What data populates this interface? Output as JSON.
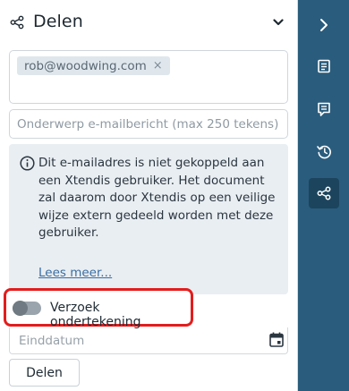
{
  "header": {
    "title": "Delen",
    "icon": "share-icon",
    "collapse_icon": "chevron-down-icon"
  },
  "recipients": {
    "chips": [
      {
        "label": "rob@woodwing.com",
        "remove": "×"
      }
    ]
  },
  "subject": {
    "value": "",
    "placeholder": "Onderwerp e-mailbericht (max 250 tekens)"
  },
  "info": {
    "icon": "info-icon",
    "message": "Dit e-mailadres is niet gekoppeld aan een Xtendis gebruiker. Het document zal daarom door Xtendis op een veilige wijze extern gedeeld worden met deze gebruiker.",
    "link": "Lees meer..."
  },
  "signature_request": {
    "label": "Verzoek ondertekening",
    "enabled": false
  },
  "end_date": {
    "value": "",
    "placeholder": "Einddatum",
    "icon": "calendar-icon"
  },
  "actions": {
    "share_label": "Delen"
  },
  "rail": {
    "items": [
      {
        "icon": "chevron-right-icon",
        "active": false
      },
      {
        "icon": "document-icon",
        "active": false
      },
      {
        "icon": "comment-icon",
        "active": false
      },
      {
        "icon": "history-icon",
        "active": false
      },
      {
        "icon": "share-icon",
        "active": true
      }
    ]
  },
  "colors": {
    "rail_bg": "#2a5c7d",
    "rail_active": "#1c445d",
    "highlight_border": "#e31d1d",
    "info_bg": "#e9eef2",
    "link": "#3a6da3"
  }
}
